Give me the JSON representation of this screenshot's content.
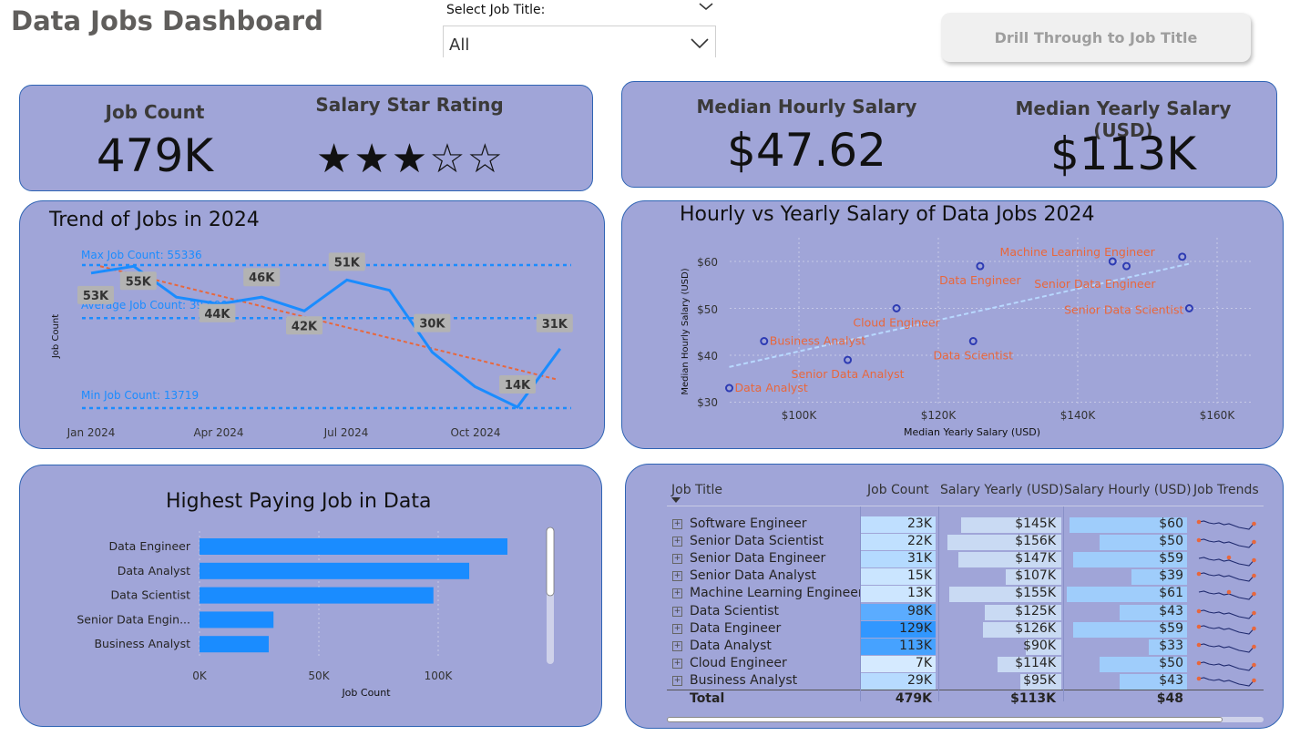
{
  "header": {
    "title": "Data Jobs Dashboard",
    "slicer_label": "Select Job Title:",
    "slicer_value": "All",
    "drill_button": "Drill Through to Job Title"
  },
  "kpi_left": {
    "job_count_label": "Job Count",
    "job_count_value": "479K",
    "rating_label": "Salary Star Rating",
    "rating_stars": "★★★☆☆",
    "rating_value": 3,
    "rating_max": 5
  },
  "kpi_right": {
    "hourly_label": "Median Hourly Salary",
    "hourly_value": "$47.62",
    "yearly_label": "Median Yearly Salary (USD)",
    "yearly_value": "$113K"
  },
  "colors": {
    "card_bg": "#a0a5d8",
    "card_border": "#2f64b4",
    "accent_blue": "#1a8cff",
    "trend_orange": "#e8673c",
    "label_orange": "#e8673c"
  },
  "trend": {
    "title": "Trend of Jobs in 2024",
    "ylabel": "Job Count",
    "x_ticks": [
      "Jan 2024",
      "Apr 2024",
      "Jul 2024",
      "Oct 2024"
    ],
    "max_label": "Max Job Count: 55336",
    "avg_label": "Average Job Count: 39,900",
    "min_label": "Min Job Count: 13719"
  },
  "scatter": {
    "title": "Hourly vs Yearly Salary of Data Jobs 2024",
    "xlabel": "Median Yearly Salary (USD)",
    "ylabel": "Median Hourly Salary (USD)",
    "x_ticks": [
      "$100K",
      "$120K",
      "$140K",
      "$160K"
    ],
    "y_ticks": [
      "$60",
      "$50",
      "$40",
      "$30"
    ]
  },
  "bar": {
    "title": "Highest Paying Job in Data",
    "xlabel": "Job Count",
    "x_ticks": [
      "0K",
      "50K",
      "100K"
    ]
  },
  "table": {
    "headers": [
      "Job Title",
      "Job Count",
      "Salary Yearly (USD)",
      "Salary Hourly (USD)",
      "Job Trends"
    ],
    "rows": [
      {
        "title": "Software Engineer",
        "count": "23K",
        "yearly": "$145K",
        "hourly": "$60"
      },
      {
        "title": "Senior Data Scientist",
        "count": "22K",
        "yearly": "$156K",
        "hourly": "$50"
      },
      {
        "title": "Senior Data Engineer",
        "count": "31K",
        "yearly": "$147K",
        "hourly": "$59"
      },
      {
        "title": "Senior Data Analyst",
        "count": "15K",
        "yearly": "$107K",
        "hourly": "$39"
      },
      {
        "title": "Machine Learning Engineer",
        "count": "13K",
        "yearly": "$155K",
        "hourly": "$61"
      },
      {
        "title": "Data Scientist",
        "count": "98K",
        "yearly": "$125K",
        "hourly": "$43"
      },
      {
        "title": "Data Engineer",
        "count": "129K",
        "yearly": "$126K",
        "hourly": "$59"
      },
      {
        "title": "Data Analyst",
        "count": "113K",
        "yearly": "$90K",
        "hourly": "$33"
      },
      {
        "title": "Cloud Engineer",
        "count": "7K",
        "yearly": "$114K",
        "hourly": "$50"
      },
      {
        "title": "Business Analyst",
        "count": "29K",
        "yearly": "$95K",
        "hourly": "$43"
      }
    ],
    "total": {
      "label": "Total",
      "count": "479K",
      "yearly": "$113K",
      "hourly": "$48"
    }
  },
  "chart_data": [
    {
      "type": "line",
      "title": "Trend of Jobs in 2024",
      "ylabel": "Job Count",
      "x": [
        "2024-01",
        "2024-02",
        "2024-03",
        "2024-04",
        "2024-05",
        "2024-06",
        "2024-07",
        "2024-08",
        "2024-09",
        "2024-10",
        "2024-11",
        "2024-12"
      ],
      "values": [
        53000,
        55000,
        46000,
        44000,
        46000,
        42000,
        51000,
        48000,
        30000,
        20000,
        14000,
        31000
      ],
      "data_labels": [
        "53K",
        "55K",
        "44K",
        "46K",
        "42K",
        "51K",
        "30K",
        "14K",
        "31K"
      ],
      "reference_lines": {
        "max": 55336,
        "average": 39900,
        "min": 13719
      },
      "trendline": true,
      "ylim": [
        10000,
        60000
      ]
    },
    {
      "type": "scatter",
      "title": "Hourly vs Yearly Salary of Data Jobs 2024",
      "xlabel": "Median Yearly Salary (USD)",
      "ylabel": "Median Hourly Salary (USD)",
      "xlim": [
        90000,
        165000
      ],
      "ylim": [
        30,
        65
      ],
      "points": [
        {
          "label": "Data Analyst",
          "x": 90000,
          "y": 33
        },
        {
          "label": "Business Analyst",
          "x": 95000,
          "y": 43
        },
        {
          "label": "Senior Data Analyst",
          "x": 107000,
          "y": 39
        },
        {
          "label": "Cloud Engineer",
          "x": 114000,
          "y": 50
        },
        {
          "label": "Data Scientist",
          "x": 125000,
          "y": 43
        },
        {
          "label": "Data Engineer",
          "x": 126000,
          "y": 59
        },
        {
          "label": "Software Engineer",
          "x": 145000,
          "y": 60
        },
        {
          "label": "Senior Data Engineer",
          "x": 147000,
          "y": 59
        },
        {
          "label": "Machine Learning Engineer",
          "x": 155000,
          "y": 61
        },
        {
          "label": "Senior Data Scientist",
          "x": 156000,
          "y": 50
        }
      ],
      "visible_labels": [
        "Data Analyst",
        "Business Analyst",
        "Senior Data Analyst",
        "Cloud Engineer",
        "Data Scientist",
        "Data Engineer",
        "Machine Learning Engineer",
        "Senior Data Engineer",
        "Senior Data Scientist"
      ],
      "trendline": true
    },
    {
      "type": "bar",
      "orientation": "horizontal",
      "title": "Highest Paying Job in Data",
      "xlabel": "Job Count",
      "categories": [
        "Data Engineer",
        "Data Analyst",
        "Data Scientist",
        "Senior Data Engin...",
        "Business Analyst"
      ],
      "values": [
        129000,
        113000,
        98000,
        31000,
        29000
      ],
      "xlim": [
        0,
        150000
      ]
    }
  ]
}
